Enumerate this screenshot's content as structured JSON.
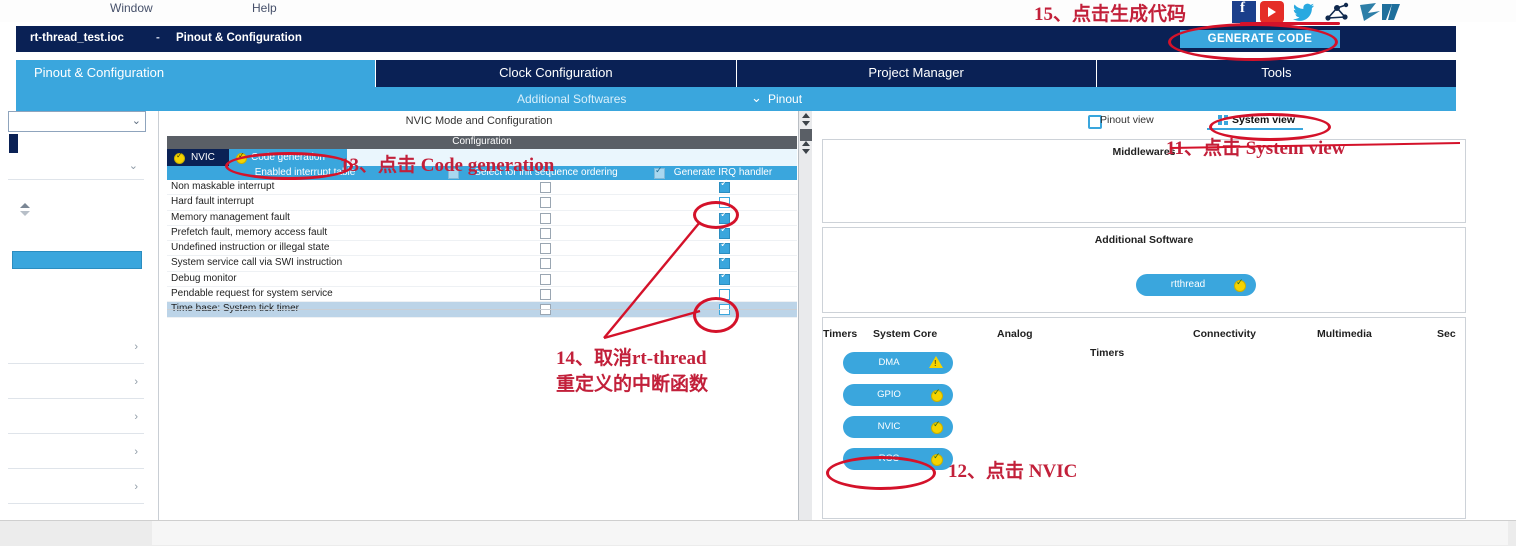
{
  "menubar": {
    "items": [
      {
        "label": "Window"
      },
      {
        "label": "Help"
      }
    ]
  },
  "social": {
    "icons": [
      "facebook-icon",
      "youtube-icon",
      "twitter-icon",
      "share-network-icon",
      "st-logo-icon"
    ]
  },
  "titlebar": {
    "file": "rt-thread_test.ioc",
    "separator": "-",
    "page": "Pinout & Configuration",
    "generate_button": "GENERATE CODE"
  },
  "tabs": [
    {
      "label": "Pinout & Configuration",
      "active": true
    },
    {
      "label": "Clock Configuration",
      "active": false
    },
    {
      "label": "Project Manager",
      "active": false
    },
    {
      "label": "Tools",
      "active": false
    }
  ],
  "subnav": {
    "additional_softwares": "Additional Softwares",
    "chevron": "⌄",
    "pinout": "Pinout"
  },
  "sidebar": {
    "combo_value": "",
    "combo_chevron": "⌄",
    "rows": [
      {
        "label": "",
        "chevron": "⌄"
      },
      {
        "label": "",
        "chevron": ""
      },
      {
        "label": "",
        "chevron": ""
      },
      {
        "label": "",
        "chevron": "›"
      },
      {
        "label": "",
        "chevron": "›"
      },
      {
        "label": "",
        "chevron": "›"
      },
      {
        "label": "",
        "chevron": "›"
      },
      {
        "label": "",
        "chevron": "›"
      }
    ]
  },
  "center": {
    "panel_title": "NVIC Mode and Configuration",
    "configuration_header": "Configuration",
    "inner_tabs": [
      {
        "label": "NVIC",
        "active": false
      },
      {
        "label": "Code generation",
        "active": true
      }
    ],
    "table": {
      "columns": [
        {
          "label": "Enabled interrupt table",
          "checkbox": false
        },
        {
          "label": "Select for init sequence ordering",
          "checkbox": true,
          "checked": false
        },
        {
          "label": "Generate IRQ handler",
          "checkbox": true,
          "checked": true
        }
      ],
      "rows": [
        {
          "name": "Non maskable interrupt",
          "init_order": false,
          "irq_handler": true,
          "selected": false
        },
        {
          "name": "Hard fault interrupt",
          "init_order": false,
          "irq_handler": false,
          "selected": false
        },
        {
          "name": "Memory management fault",
          "init_order": false,
          "irq_handler": true,
          "selected": false
        },
        {
          "name": "Prefetch fault, memory access fault",
          "init_order": false,
          "irq_handler": true,
          "selected": false
        },
        {
          "name": "Undefined instruction or illegal state",
          "init_order": false,
          "irq_handler": true,
          "selected": false
        },
        {
          "name": "System service call via SWI instruction",
          "init_order": false,
          "irq_handler": true,
          "selected": false
        },
        {
          "name": "Debug monitor",
          "init_order": false,
          "irq_handler": true,
          "selected": false
        },
        {
          "name": "Pendable request for system service",
          "init_order": false,
          "irq_handler": false,
          "selected": false
        },
        {
          "name": "Time base: System tick timer",
          "init_order": false,
          "irq_handler": false,
          "selected": true
        }
      ]
    }
  },
  "right": {
    "views": [
      {
        "label": "Pinout view",
        "active": false
      },
      {
        "label": "System view",
        "active": true
      }
    ],
    "middlewares_title": "Middlewares",
    "additional_software_title": "Additional Software",
    "additional_software_items": [
      {
        "label": "rtthread",
        "status": "ok"
      }
    ],
    "category_tabs": [
      "System Core",
      "Analog",
      "Timers",
      "Connectivity",
      "Multimedia",
      "Sec"
    ],
    "peripherals": [
      {
        "label": "DMA",
        "status": "warning"
      },
      {
        "label": "GPIO",
        "status": "ok"
      },
      {
        "label": "NVIC",
        "status": "ok"
      },
      {
        "label": "RCC",
        "status": "ok"
      }
    ]
  },
  "annotations": [
    {
      "id": "11",
      "text": "11、点击 System view"
    },
    {
      "id": "12",
      "text": "12、点击 NVIC"
    },
    {
      "id": "13",
      "text": "13、点击 Code generation"
    },
    {
      "id": "14",
      "text": "14、取消rt-thread\n重定义的中断函数"
    },
    {
      "id": "15",
      "text": "15、点击生成代码"
    }
  ],
  "colors": {
    "navy": "#0a2155",
    "accent_blue": "#3aa6dd",
    "annotation_red": "#c2203a",
    "oval_red": "#d4122a",
    "selected_row": "#bcd4e8",
    "config_header_gray": "#5a5f66"
  }
}
